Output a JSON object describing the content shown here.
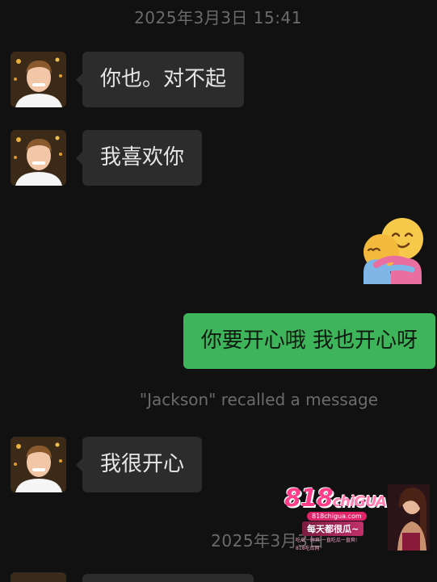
{
  "chat": {
    "timestamp_top": "2025年3月3日 15:41",
    "timestamp_bottom": "2025年3月3日",
    "messages": [
      {
        "side": "in",
        "text": "你也。对不起"
      },
      {
        "side": "in",
        "text": "我喜欢你"
      },
      {
        "side": "out",
        "type": "sticker",
        "icon": "hug-emoji-icon"
      },
      {
        "side": "out",
        "text": "你要开心哦 我也开心呀"
      },
      {
        "side": "in",
        "text": "我很开心"
      }
    ],
    "system_message": "\"Jackson\" recalled a message"
  },
  "watermark": {
    "logo": "818",
    "logo_suffix": "chiGUA",
    "site": "818chigua.com",
    "slogan": "每天都很瓜~",
    "line1": "吃瓜一时爽 一直吃瓜一直爽!",
    "line2": "818吃瓜网"
  },
  "colors": {
    "background": "#111111",
    "incoming_bubble": "#2c2c2c",
    "outgoing_bubble": "#3eb45b",
    "timestamp_text": "#6b6b6b"
  }
}
